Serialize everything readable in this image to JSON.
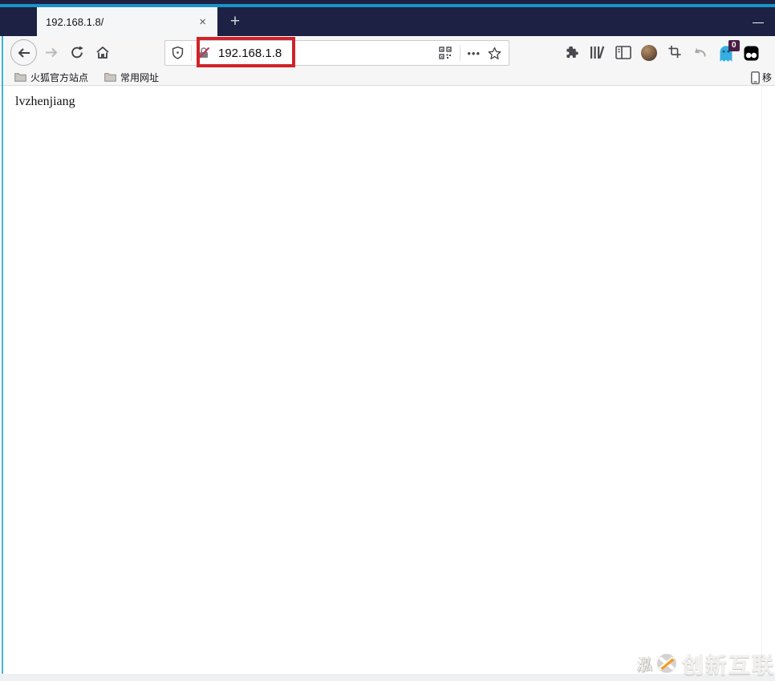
{
  "colors": {
    "titlebar": "#1d2144",
    "accent_line": "#1a94c6",
    "left_edge": "#3fb6cf",
    "toolbar_bg": "#f6f6f7",
    "tab_bg": "#f5f6f7",
    "highlight_red": "#cf2329",
    "extension_blue": "#36aee1",
    "badge_bg": "#4a1d47",
    "logo_orange": "#f59b22"
  },
  "window": {
    "minimize_label": "—"
  },
  "tabs": {
    "active": {
      "title": "192.168.1.8/",
      "close_label": "×"
    },
    "new_tab_label": "+"
  },
  "navigation": {
    "url_value": "192.168.1.8",
    "page_actions_label": "•••",
    "extension_badge": "0"
  },
  "bookmarks_bar": {
    "items": [
      {
        "label": "火狐官方站点"
      },
      {
        "label": "常用网址"
      }
    ],
    "mobile_bookmarks_label": "移"
  },
  "content": {
    "body_text": "lvzhenjiang"
  },
  "watermark": {
    "side_glyph": "泓",
    "brand_text": "创新互联"
  }
}
